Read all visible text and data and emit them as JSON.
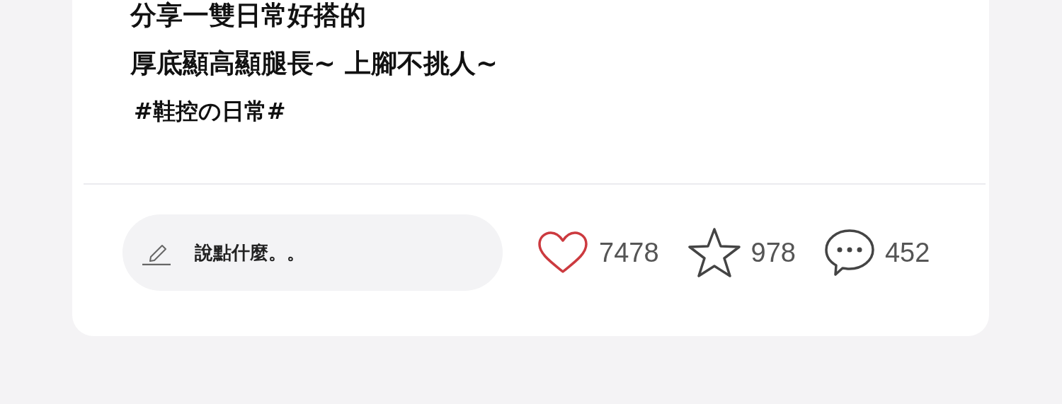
{
  "post": {
    "lines": [
      "分享一雙日常好搭的",
      "厚底顯高顯腿長~ 上腳不挑人~"
    ],
    "hashtag": "#鞋控の日常#"
  },
  "comment_field": {
    "placeholder": "說點什麼。。"
  },
  "stats": [
    {
      "kind": "like",
      "count": "7478"
    },
    {
      "kind": "favorite",
      "count": "978"
    },
    {
      "kind": "comment",
      "count": "452"
    }
  ]
}
